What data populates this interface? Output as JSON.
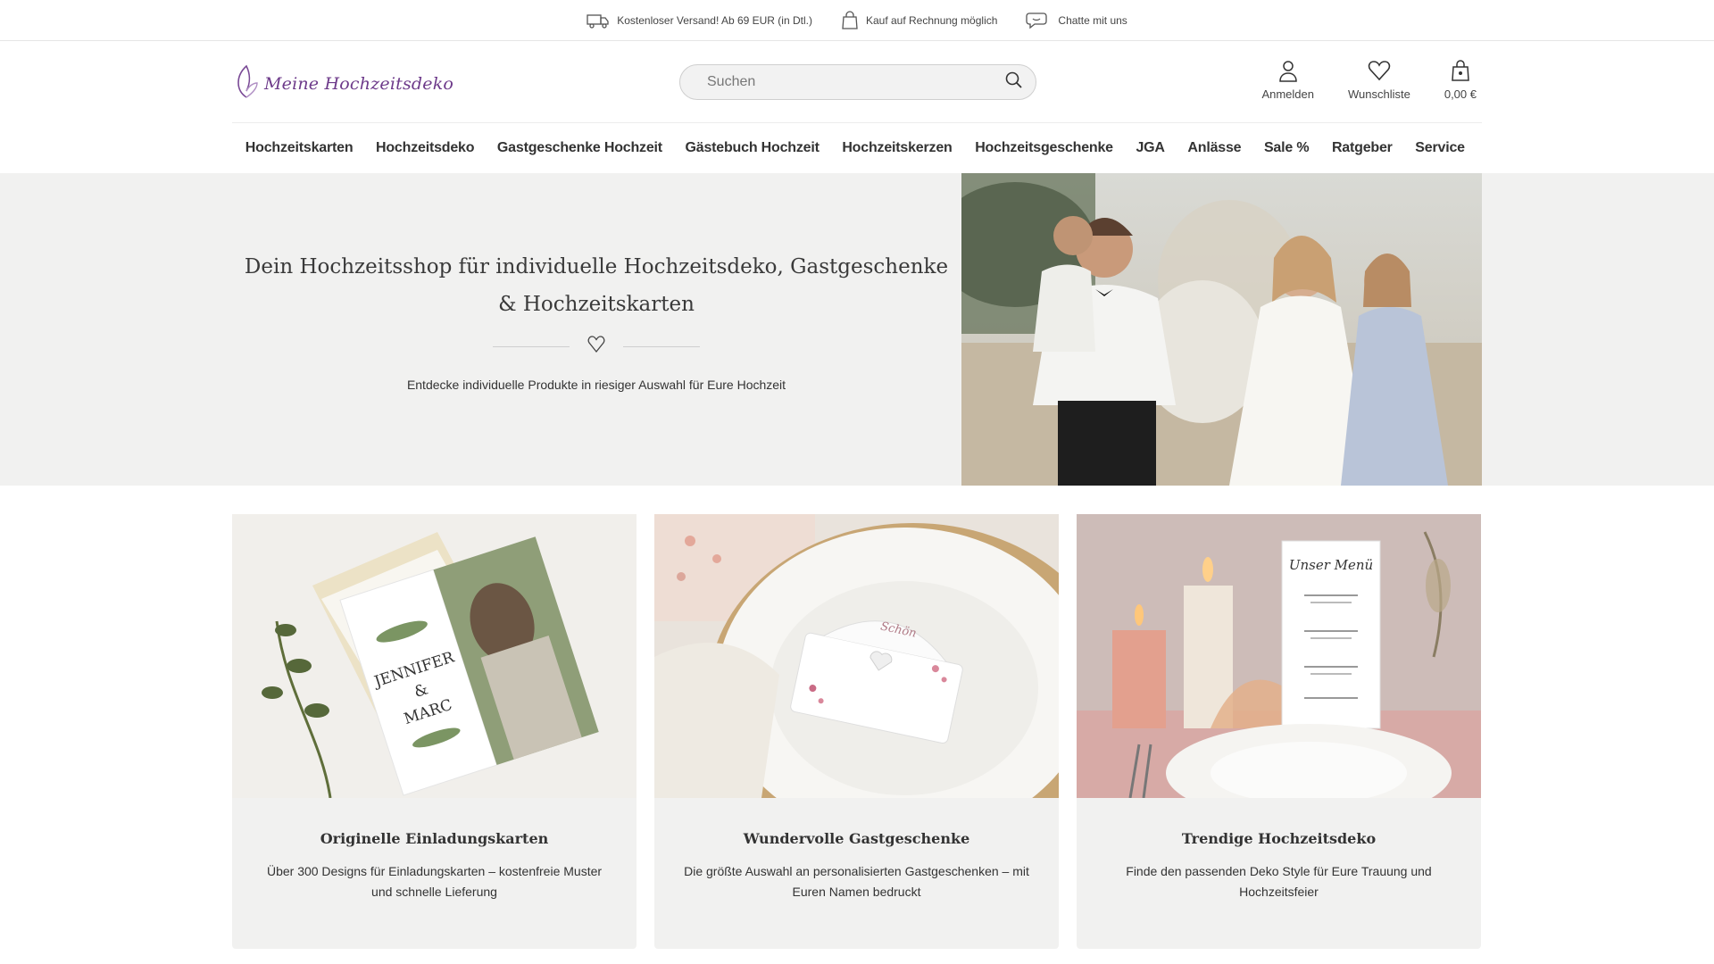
{
  "topbar": {
    "shipping": "Kostenloser Versand! Ab 69 EUR (in Dtl.)",
    "invoice": "Kauf auf Rechnung möglich",
    "chat": "Chatte mit uns"
  },
  "header": {
    "logo": "Meine Hochzeitsdeko",
    "search_placeholder": "Suchen",
    "login": "Anmelden",
    "wishlist": "Wunschliste",
    "cart_total": "0,00 €"
  },
  "nav": [
    "Hochzeitskarten",
    "Hochzeitsdeko",
    "Gastgeschenke Hochzeit",
    "Gästebuch Hochzeit",
    "Hochzeitskerzen",
    "Hochzeitsgeschenke",
    "JGA",
    "Anlässe",
    "Sale %",
    "Ratgeber",
    "Service"
  ],
  "hero": {
    "title_line1": "Dein Hochzeitsshop für individuelle Hochzeitsdeko, Gastgeschenke",
    "title_line2": "& Hochzeitskarten",
    "subtitle": "Entdecke individuelle Produkte in riesiger Auswahl für Eure Hochzeit"
  },
  "cards": [
    {
      "title": "Originelle Einladungskarten",
      "desc": "Über 300 Designs für Einladungskarten – kostenfreie Muster und schnelle Lieferung",
      "card_text_1": "JENNIFER",
      "card_text_2": "&",
      "card_text_3": "MARC"
    },
    {
      "title": "Wundervolle Gastgeschenke",
      "desc": "Die größte Auswahl an personalisierten Gastgeschenken – mit Euren Namen bedruckt",
      "card_text_1": "Schön"
    },
    {
      "title": "Trendige Hochzeitsdeko",
      "desc": "Finde den passenden Deko Style für Eure Trauung und Hochzeitsfeier",
      "card_text_1": "Unser Menü"
    }
  ],
  "colors": {
    "brand": "#6d3a8a",
    "hero_bg": "#f1f1f0",
    "card_bg": "#f1f1f0"
  }
}
